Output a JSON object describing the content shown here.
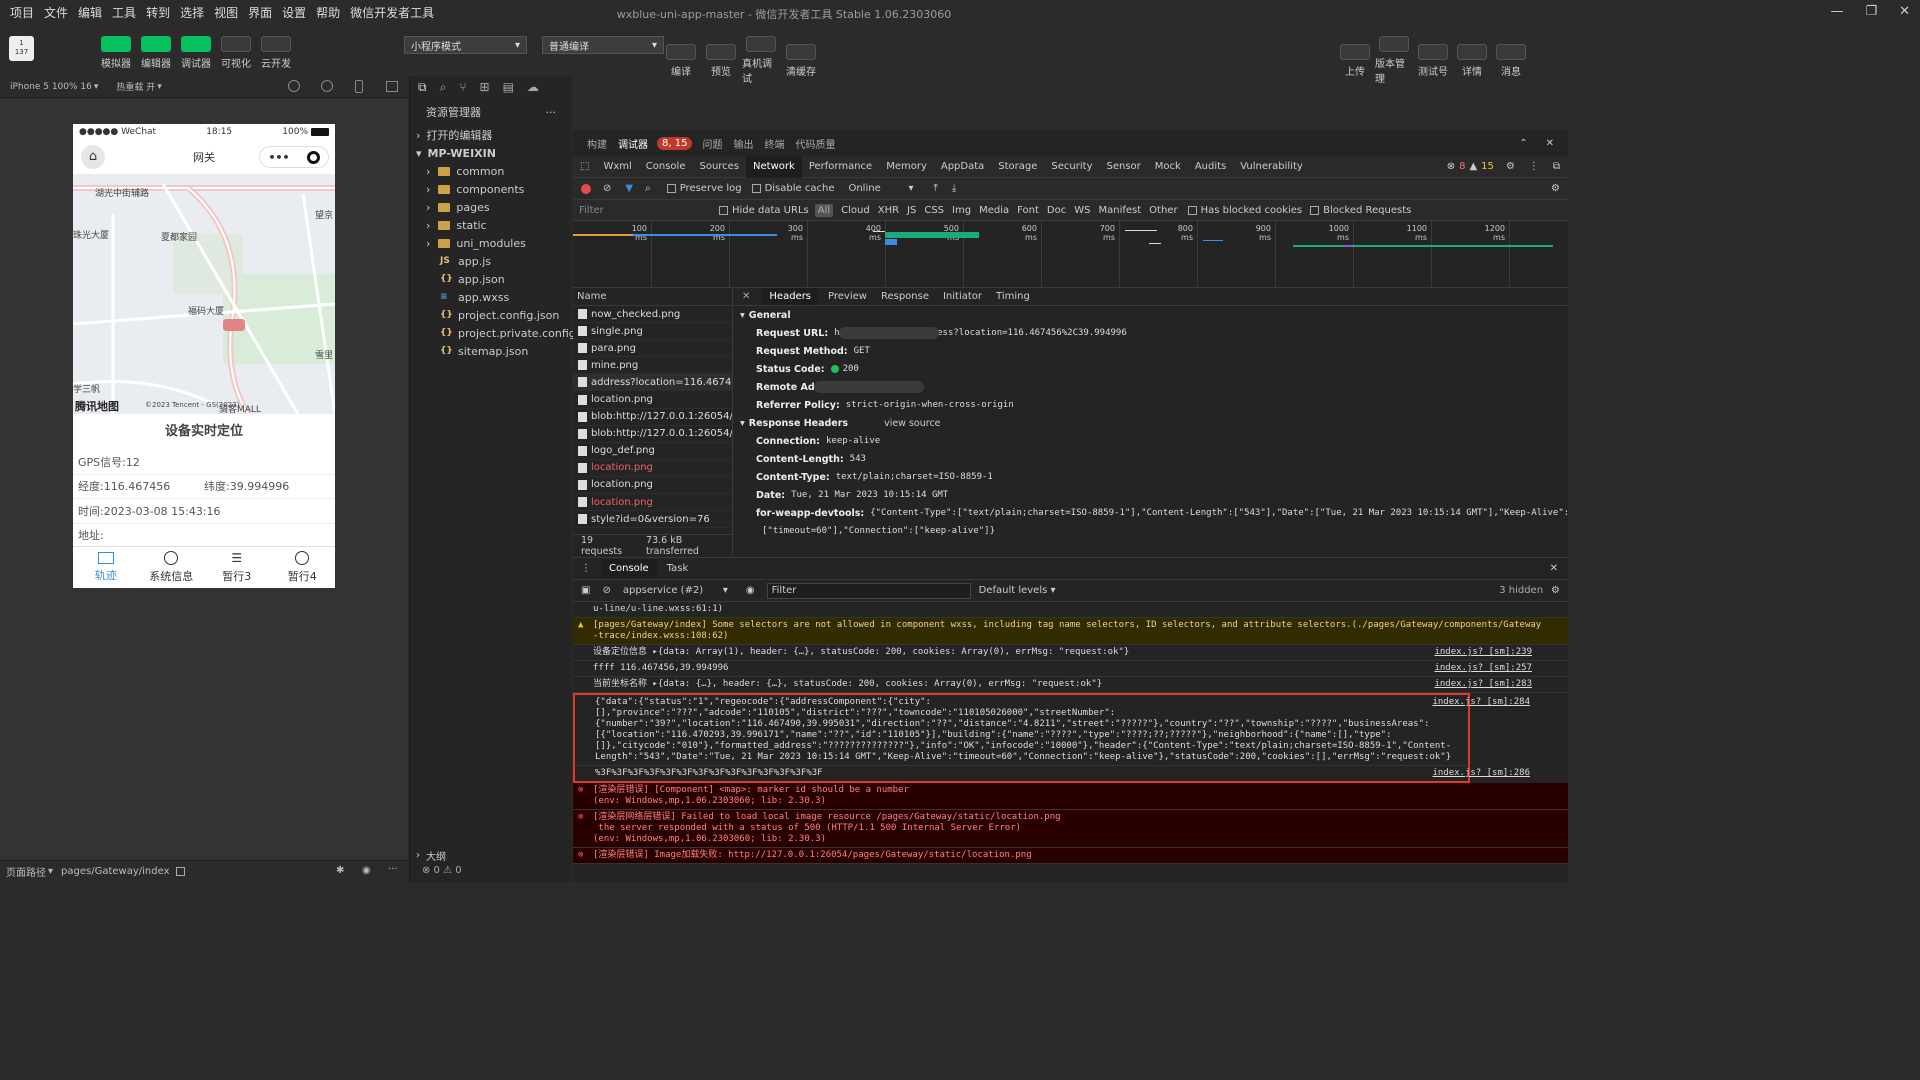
{
  "menu": [
    "项目",
    "文件",
    "编辑",
    "工具",
    "转到",
    "选择",
    "视图",
    "界面",
    "设置",
    "帮助",
    "微信开发者工具"
  ],
  "window_title": "wxblue-uni-app-master - 微信开发者工具 Stable 1.06.2303060",
  "toolbar": {
    "left": [
      "模拟器",
      "编辑器",
      "调试器",
      "可视化",
      "云开发"
    ],
    "mode": "小程序模式",
    "compile_mode": "普通编译",
    "mid": [
      "编译",
      "预览",
      "真机调试",
      "清缓存"
    ],
    "right": [
      "上传",
      "版本管理",
      "测试号",
      "详情",
      "消息"
    ]
  },
  "sim": {
    "device": "iPhone 5 100% 16",
    "hot": "热重载 开",
    "carrier": "●●●●● WeChat",
    "time": "18:15",
    "battery": "100%",
    "nav_title": "网关",
    "map_labels": [
      "湖光中街辅路",
      "珠光大厦",
      "夏都家园",
      "福码大厦",
      "望京",
      "雪里",
      "学三帆",
      "骑客MALL"
    ],
    "map_attr": "©2023 Tencent - GS(2023)",
    "map_logo": "腾讯地图",
    "title": "设备实时定位",
    "gps": "GPS信号:12",
    "lng": "经度:116.467456",
    "lat": "纬度:39.994996",
    "time_row": "时间:2023-03-08 15:43:16",
    "addr": "地址:",
    "tabs": [
      "轨迹",
      "系统信息",
      "暂行3",
      "暂行4"
    ],
    "path_label": "页面路径",
    "path": "pages/Gateway/index"
  },
  "explorer": {
    "title": "资源管理器",
    "open_editors": "打开的编辑器",
    "project": "MP-WEIXIN",
    "folders": [
      "common",
      "components",
      "pages",
      "static",
      "uni_modules"
    ],
    "files": [
      "app.js",
      "app.json",
      "app.wxss",
      "project.config.json",
      "project.private.config.js...",
      "sitemap.json"
    ],
    "outline": "大纲",
    "status": "⊗ 0 ⚠ 0"
  },
  "devtools": {
    "top_tabs": [
      "构建",
      "调试器",
      "问题",
      "输出",
      "终端",
      "代码质量"
    ],
    "badge": "8, 15",
    "tabs": [
      "Wxml",
      "Console",
      "Sources",
      "Network",
      "Performance",
      "Memory",
      "AppData",
      "Storage",
      "Security",
      "Sensor",
      "Mock",
      "Audits",
      "Vulnerability"
    ],
    "counts": {
      "err": "8",
      "warn": "15"
    },
    "ntool": {
      "preserve": "Preserve log",
      "disable": "Disable cache",
      "online": "Online"
    },
    "nfilter": {
      "placeholder": "Filter",
      "hide": "Hide data URLs",
      "types": [
        "All",
        "Cloud",
        "XHR",
        "JS",
        "CSS",
        "Img",
        "Media",
        "Font",
        "Doc",
        "WS",
        "Manifest",
        "Other"
      ],
      "blocked_cookies": "Has blocked cookies",
      "blocked_req": "Blocked Requests"
    },
    "ticks": [
      "100 ms",
      "200 ms",
      "300 ms",
      "400 ms",
      "500 ms",
      "600 ms",
      "700 ms",
      "800 ms",
      "900 ms",
      "1000 ms",
      "1100 ms",
      "1200 ms"
    ],
    "list_header": "Name",
    "requests": [
      "now_checked.png",
      "single.png",
      "para.png",
      "mine.png",
      "address?location=116.467456...",
      "location.png",
      "blob:http://127.0.0.1:26054/a7",
      "blob:http://127.0.0.1:26054/a7",
      "logo_def.png",
      "location.png",
      "location.png",
      "location.png",
      "style?id=0&version=76"
    ],
    "summary": {
      "requests": "19 requests",
      "transferred": "73.6 kB transferred"
    },
    "htabs": [
      "Headers",
      "Preview",
      "Response",
      "Initiator",
      "Timing"
    ],
    "general_title": "General",
    "general": [
      {
        "k": "Request URL:",
        "v": "http:/                    devices/address?location=116.467456%2C39.994996"
      },
      {
        "k": "Request Method:",
        "v": "GET"
      },
      {
        "k": "Status Code:",
        "v": "200"
      },
      {
        "k": "Remote Address:",
        "v": ""
      },
      {
        "k": "Referrer Policy:",
        "v": "strict-origin-when-cross-origin"
      }
    ],
    "resp_title": "Response Headers",
    "view_source": "view source",
    "resp": [
      {
        "k": "Connection:",
        "v": "keep-alive"
      },
      {
        "k": "Content-Length:",
        "v": "543"
      },
      {
        "k": "Content-Type:",
        "v": "text/plain;charset=ISO-8859-1"
      },
      {
        "k": "Date:",
        "v": "Tue, 21 Mar 2023 10:15:14 GMT"
      },
      {
        "k": "for-weapp-devtools:",
        "v": "{\"Content-Type\":[\"text/plain;charset=ISO-8859-1\"],\"Content-Length\":[\"543\"],\"Date\":[\"Tue, 21 Mar 2023 10:15:14 GMT\"],\"Keep-Alive\":"
      },
      {
        "k": "",
        "v": "[\"timeout=60\"],\"Connection\":[\"keep-alive\"]}"
      }
    ],
    "console_tabs": [
      "Console",
      "Task"
    ],
    "context": "appservice (#2)",
    "cfilter": "Filter",
    "levels": "Default levels ▾",
    "hidden": "3 hidden",
    "logs": [
      {
        "t": "u-line/u-line.wxss:61:1)",
        "src": "",
        "k": ""
      },
      {
        "t": "[pages/Gateway/index] Some selectors are not allowed in component wxss, including tag name selectors, ID selectors, and attribute selectors.(./pages/Gateway/components/Gateway\n-trace/index.wxss:108:62)",
        "src": "",
        "k": "warn"
      },
      {
        "t": "设备定位信息 ▸{data: Array(1), header: {…}, statusCode: 200, cookies: Array(0), errMsg: \"request:ok\"}",
        "src": "index.js? [sm]:239",
        "k": ""
      },
      {
        "t": "ffff 116.467456,39.994996",
        "src": "index.js? [sm]:257",
        "k": ""
      },
      {
        "t": "当前坐标名称 ▸{data: {…}, header: {…}, statusCode: 200, cookies: Array(0), errMsg: \"request:ok\"}",
        "src": "index.js? [sm]:283",
        "k": ""
      },
      {
        "t": "{\"data\":{\"status\":\"1\",\"regeocode\":{\"addressComponent\":{\"city\":\n[],\"province\":\"???\",\"adcode\":\"110105\",\"district\":\"???\",\"towncode\":\"110105026000\",\"streetNumber\":\n{\"number\":\"39?\",\"location\":\"116.467490,39.995031\",\"direction\":\"??\",\"distance\":\"4.8211\",\"street\":\"?????\"},\"country\":\"??\",\"township\":\"????\",\"businessAreas\":\n[{\"location\":\"116.470293,39.996171\",\"name\":\"??\",\"id\":\"110105\"}],\"building\":{\"name\":\"????\",\"type\":\"????;??;?????\"},\"neighborhood\":{\"name\":[],\"type\":\n[]},\"citycode\":\"010\"},\"formatted_address\":\"??????????????\"},\"info\":\"OK\",\"infocode\":\"10000\"},\"header\":{\"Content-Type\":\"text/plain;charset=ISO-8859-1\",\"Content-\nLength\":\"543\",\"Date\":\"Tue, 21 Mar 2023 10:15:14 GMT\",\"Keep-Alive\":\"timeout=60\",\"Connection\":\"keep-alive\"},\"statusCode\":200,\"cookies\":[],\"errMsg\":\"request:ok\"}",
        "src": "index.js? [sm]:284",
        "k": "box"
      },
      {
        "t": "%3F%3F%3F%3F%3F%3F%3F%3F%3F%3F%3F%3F%3F%3F",
        "src": "index.js? [sm]:286",
        "k": "box2"
      },
      {
        "t": "[渲染层错误] [Component] <map>: marker id should be a number\n(env: Windows,mp,1.06.2303060; lib: 2.30.3)",
        "src": "",
        "k": "err"
      },
      {
        "t": "[渲染层网络层错误] Failed to load local image resource /pages/Gateway/static/location.png\n the server responded with a status of 500 (HTTP/1.1 500 Internal Server Error)\n(env: Windows,mp,1.06.2303060; lib: 2.30.3)",
        "src": "",
        "k": "err"
      },
      {
        "t": "[渲染层错误] Image加载失败: http://127.0.0.1:26054/pages/Gateway/static/location.png",
        "src": "",
        "k": "err"
      }
    ]
  },
  "colors": {
    "accent": "#07c160",
    "highlight": "#e0392b",
    "active_tab": "#3c8dd9"
  }
}
